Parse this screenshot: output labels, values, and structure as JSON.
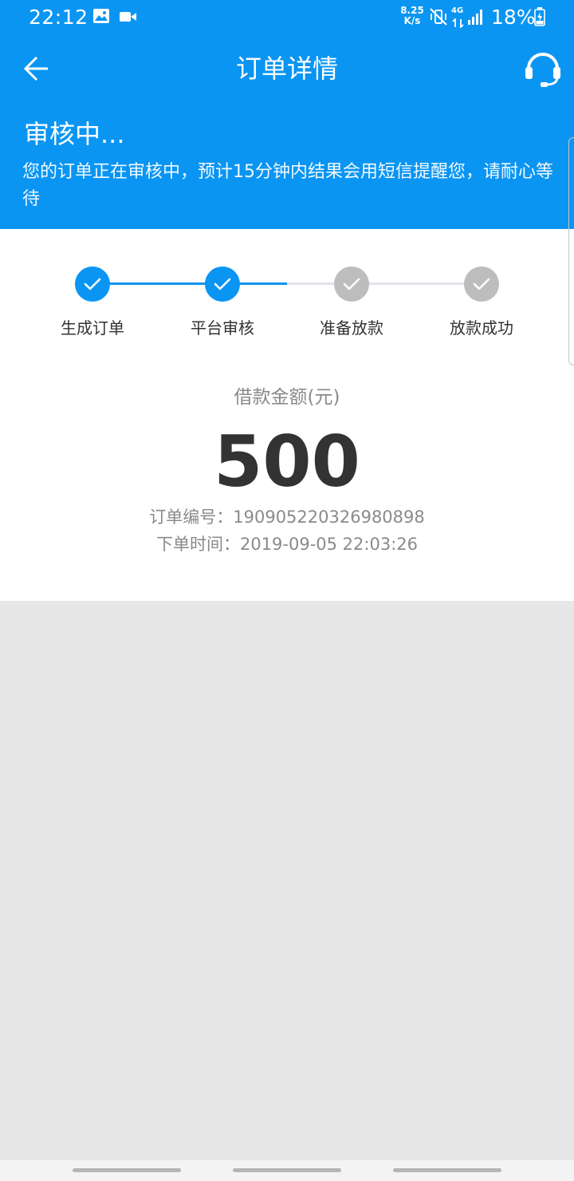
{
  "status_bar": {
    "time": "22:12",
    "net_speed_value": "8.25",
    "net_speed_unit": "K/s",
    "network_type": "4G",
    "battery_percent": "18%",
    "icons": [
      "image-icon",
      "video-icon",
      "mute-vibrate-icon",
      "data-arrows-icon",
      "signal-icon",
      "battery-charging-icon"
    ]
  },
  "nav": {
    "title": "订单详情",
    "back_icon": "back-arrow-icon",
    "service_icon": "headset-icon"
  },
  "review": {
    "title": "审核中...",
    "description": "您的订单正在审核中，预计15分钟内结果会用短信提醒您，请耐心等待"
  },
  "steps": [
    {
      "label": "生成订单",
      "state": "done"
    },
    {
      "label": "平台审核",
      "state": "done"
    },
    {
      "label": "准备放款",
      "state": "pending"
    },
    {
      "label": "放款成功",
      "state": "pending"
    }
  ],
  "loan": {
    "amount_label": "借款金额(元)",
    "amount": "500",
    "order_no_line": "订单编号：19090522032698089​8",
    "order_time_line": "下单时间：2019-09-05 22:03:26"
  },
  "colors": {
    "primary": "#0a95f3",
    "step_done": "#0a95f3",
    "step_pending": "#bdbdbd",
    "track_pending": "#dfe3e8",
    "page_bg": "#e7e7e7"
  }
}
